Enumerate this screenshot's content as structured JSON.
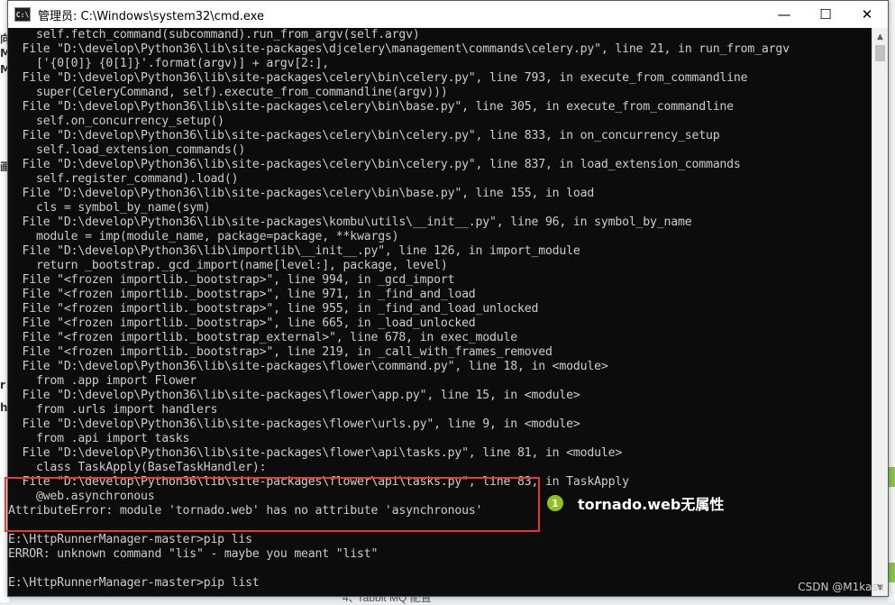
{
  "window": {
    "title": "管理员: C:\\Windows\\system32\\cmd.exe",
    "icon": "cmd-icon"
  },
  "controls": {
    "minimize": "—",
    "maximize": "☐",
    "close": "✕"
  },
  "console_lines": [
    "    self.fetch_command(subcommand).run_from_argv(self.argv)",
    "  File \"D:\\develop\\Python36\\lib\\site-packages\\djcelery\\management\\commands\\celery.py\", line 21, in run_from_argv",
    "    ['{0[0]} {0[1]}'.format(argv)] + argv[2:],",
    "  File \"D:\\develop\\Python36\\lib\\site-packages\\celery\\bin\\celery.py\", line 793, in execute_from_commandline",
    "    super(CeleryCommand, self).execute_from_commandline(argv)))",
    "  File \"D:\\develop\\Python36\\lib\\site-packages\\celery\\bin\\base.py\", line 305, in execute_from_commandline",
    "    self.on_concurrency_setup()",
    "  File \"D:\\develop\\Python36\\lib\\site-packages\\celery\\bin\\celery.py\", line 833, in on_concurrency_setup",
    "    self.load_extension_commands()",
    "  File \"D:\\develop\\Python36\\lib\\site-packages\\celery\\bin\\celery.py\", line 837, in load_extension_commands",
    "    self.register_command).load()",
    "  File \"D:\\develop\\Python36\\lib\\site-packages\\celery\\bin\\base.py\", line 155, in load",
    "    cls = symbol_by_name(sym)",
    "  File \"D:\\develop\\Python36\\lib\\site-packages\\kombu\\utils\\__init__.py\", line 96, in symbol_by_name",
    "    module = imp(module_name, package=package, **kwargs)",
    "  File \"D:\\develop\\Python36\\lib\\importlib\\__init__.py\", line 126, in import_module",
    "    return _bootstrap._gcd_import(name[level:], package, level)",
    "  File \"<frozen importlib._bootstrap>\", line 994, in _gcd_import",
    "  File \"<frozen importlib._bootstrap>\", line 971, in _find_and_load",
    "  File \"<frozen importlib._bootstrap>\", line 955, in _find_and_load_unlocked",
    "  File \"<frozen importlib._bootstrap>\", line 665, in _load_unlocked",
    "  File \"<frozen importlib._bootstrap_external>\", line 678, in exec_module",
    "  File \"<frozen importlib._bootstrap>\", line 219, in _call_with_frames_removed",
    "  File \"D:\\develop\\Python36\\lib\\site-packages\\flower\\command.py\", line 18, in <module>",
    "    from .app import Flower",
    "  File \"D:\\develop\\Python36\\lib\\site-packages\\flower\\app.py\", line 15, in <module>",
    "    from .urls import handlers",
    "  File \"D:\\develop\\Python36\\lib\\site-packages\\flower\\urls.py\", line 9, in <module>",
    "    from .api import tasks",
    "  File \"D:\\develop\\Python36\\lib\\site-packages\\flower\\api\\tasks.py\", line 81, in <module>",
    "    class TaskApply(BaseTaskHandler):",
    "  File \"D:\\develop\\Python36\\lib\\site-packages\\flower\\api\\tasks.py\", line 83, in TaskApply",
    "    @web.asynchronous",
    "AttributeError: module 'tornado.web' has no attribute 'asynchronous'",
    "",
    "E:\\HttpRunnerManager-master>pip lis",
    "ERROR: unknown command \"lis\" - maybe you meant \"list\"",
    "",
    "E:\\HttpRunnerManager-master>pip list"
  ],
  "annotation": {
    "number": "1",
    "text": "tornado.web无属性"
  },
  "watermark": "CSDN @M1kasa",
  "background": {
    "bottom_text": "4、rabbit MQ 配置",
    "left_marks": [
      "向",
      "M",
      "M",
      "画",
      "r",
      "h"
    ]
  },
  "colors": {
    "console_bg": "#0c0c0c",
    "console_text": "#cccccc",
    "highlight": "#e53935",
    "annotation_badge": "#8dc21f"
  }
}
